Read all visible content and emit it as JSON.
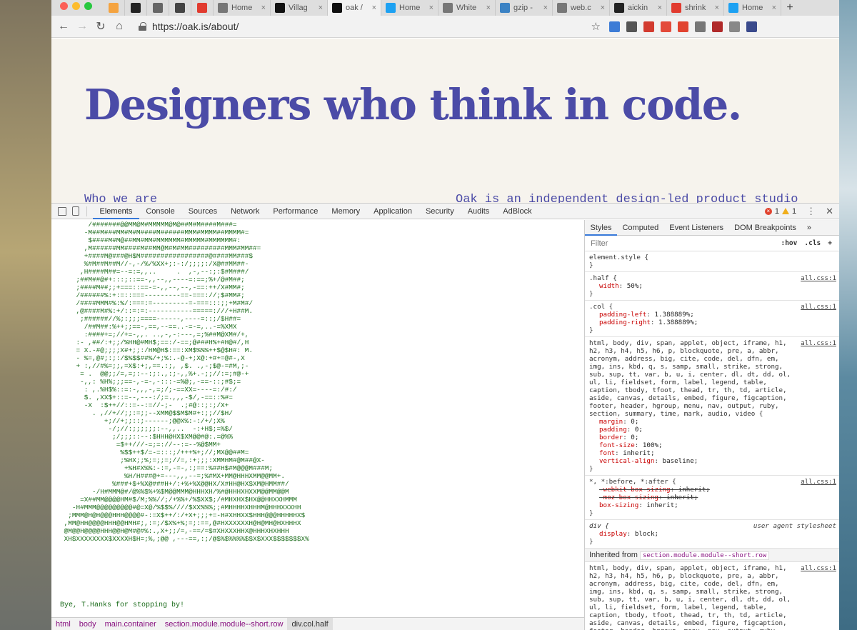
{
  "browser": {
    "tabs": [
      {
        "title": "",
        "icon": "bookmark-icon",
        "color": "#f4a340"
      },
      {
        "title": "",
        "icon": "github-icon",
        "color": "#222222"
      },
      {
        "title": "",
        "icon": "code-icon",
        "color": "#666666"
      },
      {
        "title": "",
        "icon": "person-icon",
        "color": "#444444"
      },
      {
        "title": "",
        "icon": "s-logo-icon",
        "color": "#e13b2f"
      },
      {
        "title": "Home",
        "icon": "page-icon",
        "color": "#777777"
      },
      {
        "title": "Villag",
        "icon": "hi-logo-icon",
        "color": "#111111"
      },
      {
        "title": "oak /",
        "icon": "oak-icon",
        "color": "#111111",
        "active": true
      },
      {
        "title": "Home",
        "icon": "twitter-icon",
        "color": "#1da1f2"
      },
      {
        "title": "White",
        "icon": "page-icon",
        "color": "#777777"
      },
      {
        "title": "gzip -",
        "icon": "shield-icon",
        "color": "#3b82c4"
      },
      {
        "title": "web.c",
        "icon": "page-icon",
        "color": "#777777"
      },
      {
        "title": "aickin",
        "icon": "github-icon",
        "color": "#222222"
      },
      {
        "title": "shrink",
        "icon": "square-logo-icon",
        "color": "#e13b2f"
      },
      {
        "title": "Home",
        "icon": "twitter-icon",
        "color": "#1da1f2"
      }
    ],
    "url": "https://oak.is/about/",
    "extensions": [
      "#3d7cd6",
      "#555555",
      "#d23b2f",
      "#e34a3a",
      "#e1432f",
      "#777777",
      "#b02a2a",
      "#888888",
      "#3a4a8c"
    ]
  },
  "page": {
    "hero": "Designers who think in code.",
    "sub_left": "Who we are",
    "sub_right": "Oak is an independent design-led product studio"
  },
  "devtools": {
    "tabs": [
      "Elements",
      "Console",
      "Sources",
      "Network",
      "Performance",
      "Memory",
      "Application",
      "Security",
      "Audits",
      "AdBlock"
    ],
    "errors": "1",
    "warnings": "1",
    "console_signoff": "Bye, T.Hanks for stopping by!",
    "ascii_art": "       /#######@@MM@M#MMMMM@M@##M#M####M###=\n      -M##M###MM#M#M####M######MMM#MMMM##MMMM#=\n       $####M#M@##MM#MM#MMMMMM#MMMMM#MMMMMM#:\n      ,M######MM####M##MM@M#M#MM#########MMM#MM##=\n      +####M@###@H$M#################@####MM###$\n      %#M##M##M//-,-/%/%XX+;:-:/;;;;:/X@##MM##-\n     ,H####M##=--=:=,,..     .  ,-,--:;:$#M###/\n    ;##M##@#+:::;::==-,,--,,----=:==;%+/@#M##;\n    ;####M##;;+===::==-=-,,--,--,-==:++/X#MM#;\n    /######%:+:=::===---------==-===://;$#MM#;\n    /####MMM#%:%/:===:=---------=-===:::;;+M#M#/\n    ,@####M#%:+/::=:=:-----------=====:///+H##M.\n     ;######//%;:;;;====------,----=::;/$H##=\n      /##M##:%++;;==-,==,--==..-=-=,..-=%XMX\n      :####+=;//+=-,,. ..,-,-:---,=;%##M@XM#/+,\n    :- ,##/:+;;/%HH@#MH$;==:/-==;@###H%+#H@#/,H\n    = X.-#@;;;;X#+;;:/HM@H$:==:XM$%%%++$@$H#: M.\n    - %=,@#;:;:/$%$$##%/+;%:.-@-+;X@:+#+=@#-,X\n    + :,//#%=;;,=X$:+;,==.:;, ,$. .,-;$@-=#M,;-\n     = .  @@;;/=,=;:--:;:.,:;-,,%+.-;;//:=;#@-+\n     -,,: %H%;;;==-,-=-,-:::-=%@;,-==-::;#$;=\n      : ,.%H$%::=:-,,,-,=;/;-==XX=----=:/#:/\n      $. ,XX$+::=--,---:/;=.,,,-$/,-==::%#=\n      -X  :$++//::=--:=//-;-  .;#@::;:;/X+\n        . ,//+//;;:=;;--XMM@$$M$M#+:;;//$H/\n           +;//+;;::;------;@@X%:-:/+/;X%\n            -/;//:;;;;;;:--,,..  -:+H$;=%$/\n             ;/;;;::--:$HHH@HX$XM@@#@:.=@%%\n              =$++///-=;=://--:=--%@$MM+\n               %$$++$/=-=:::;/+++%+;//;MX@@##M=\n               ;%HX;;%;=;;=;//=,:+;;;:XMMHM#@M##@X-\n                +%H#X%%:-:=,-=-,:;==:%##H$#M@@@M###M;\n                %H/H###@+=---,,,--=;%#MX+MM@HHHXMM@@MM+.\n             %###+$+%X@###H+/:+%+%X@@HX/X#HH@HX$XM@HMM##/\n        -/H#MMM@#/@%%$%+%$M@@MMM@HHHXH/%#@HHHXHXXM@@MM@@M\n     =X##MM@@@@HM#$/M;%%//;/+%%+/%$XX$;/#MHXHX$HX@@HHXXHMMM\n   -H#MMM@@@@@@@@@#@=X@/%$$%////$XX%%%;;#MHHHHXHHHM@HHHXXXHH\n  ;MMM@H@H@@@HHH@@@@#-:=X$++/:/+X+;;;+=-H#XHHXX$HHH@@@HHHHHX$\n ,MM@HH@@@@HHH@@HMH#;,:=;/$X%+%;=;:==,@#HXXXXXXH@H@MH@HXHHHX\n @M@@H@@@@HHH@@H@M#@#%:.,X+;;/=,-==/=$#XHXXXHHX@HHHXHXHHH\n XH$XXXXXXXX$XXXXH$H=;%,;@@ ,---==,:;/@$%$%%%%$$X$XXX$$$$$$$X%",
    "breadcrumbs": [
      "html",
      "body",
      "main.container",
      "section.module.module--short.row",
      "div.col.half"
    ],
    "styles_panel": {
      "tabs": [
        "Styles",
        "Computed",
        "Event Listeners",
        "DOM Breakpoints"
      ],
      "filter_placeholder": "Filter",
      "hov": ":hov",
      "cls": ".cls",
      "element_style": "element.style {",
      "half_selector": ".half {",
      "half_width": "50%;",
      "col_selector": ".col {",
      "col_padding_left": "1.388889%;",
      "col_padding_right": "1.388889%;",
      "reset_selector": "html, body, div, span, applet, object, iframe, h1, h2, h3, h4, h5, h6, p, blockquote, pre, a, abbr, acronym, address, big, cite, code, del, dfn, em, img, ins, kbd, q, s, samp, small, strike, strong, sub, sup, tt, var, b, u, i, center, dl, dt, dd, ol, ul, li, fieldset, form, label, legend, table, caption, tbody, tfoot, thead, tr, th, td, article, aside, canvas, details, embed, figure, figcaption, footer, header, hgroup, menu, nav, output, ruby, section, summary, time, mark, audio, video {",
      "reset_props": [
        {
          "name": "margin",
          "value": "0;"
        },
        {
          "name": "padding",
          "value": "0;"
        },
        {
          "name": "border",
          "value": "0;"
        },
        {
          "name": "font-size",
          "value": "100%;"
        },
        {
          "name": "font",
          "value": "inherit;"
        },
        {
          "name": "vertical-align",
          "value": "baseline;"
        }
      ],
      "box_selector": "*, *:before, *:after {",
      "box_props": [
        {
          "name": "-webkit-box-sizing",
          "value": "inherit;",
          "struck": true
        },
        {
          "name": "-moz-box-sizing",
          "value": "inherit;",
          "struck": true
        },
        {
          "name": "box-sizing",
          "value": "inherit;"
        }
      ],
      "ua_selector": "div {",
      "ua_source": "user agent stylesheet",
      "ua_display": "block;",
      "source": "all.css:1",
      "inherited_from": "Inherited from",
      "inherited_element": "section.module.module--short.row",
      "inherited_selector": "html, body, div, span, applet, object, iframe, h1, h2, h3, h4, h5, h6, p, blockquote, pre, a, abbr, acronym, address, big, cite, code, del, dfn, em, img, ins, kbd, q, s, samp, small, strike, strong, sub, sup, tt, var, b, u, i, center, dl, dt, dd, ol, ul, li, fieldset, form, label, legend, table, caption, tbody, tfoot, thead, tr, th, td, article, aside, canvas, details, embed, figure, figcaption, footer, header, hgroup, menu, nav, output, ruby, section"
    }
  }
}
